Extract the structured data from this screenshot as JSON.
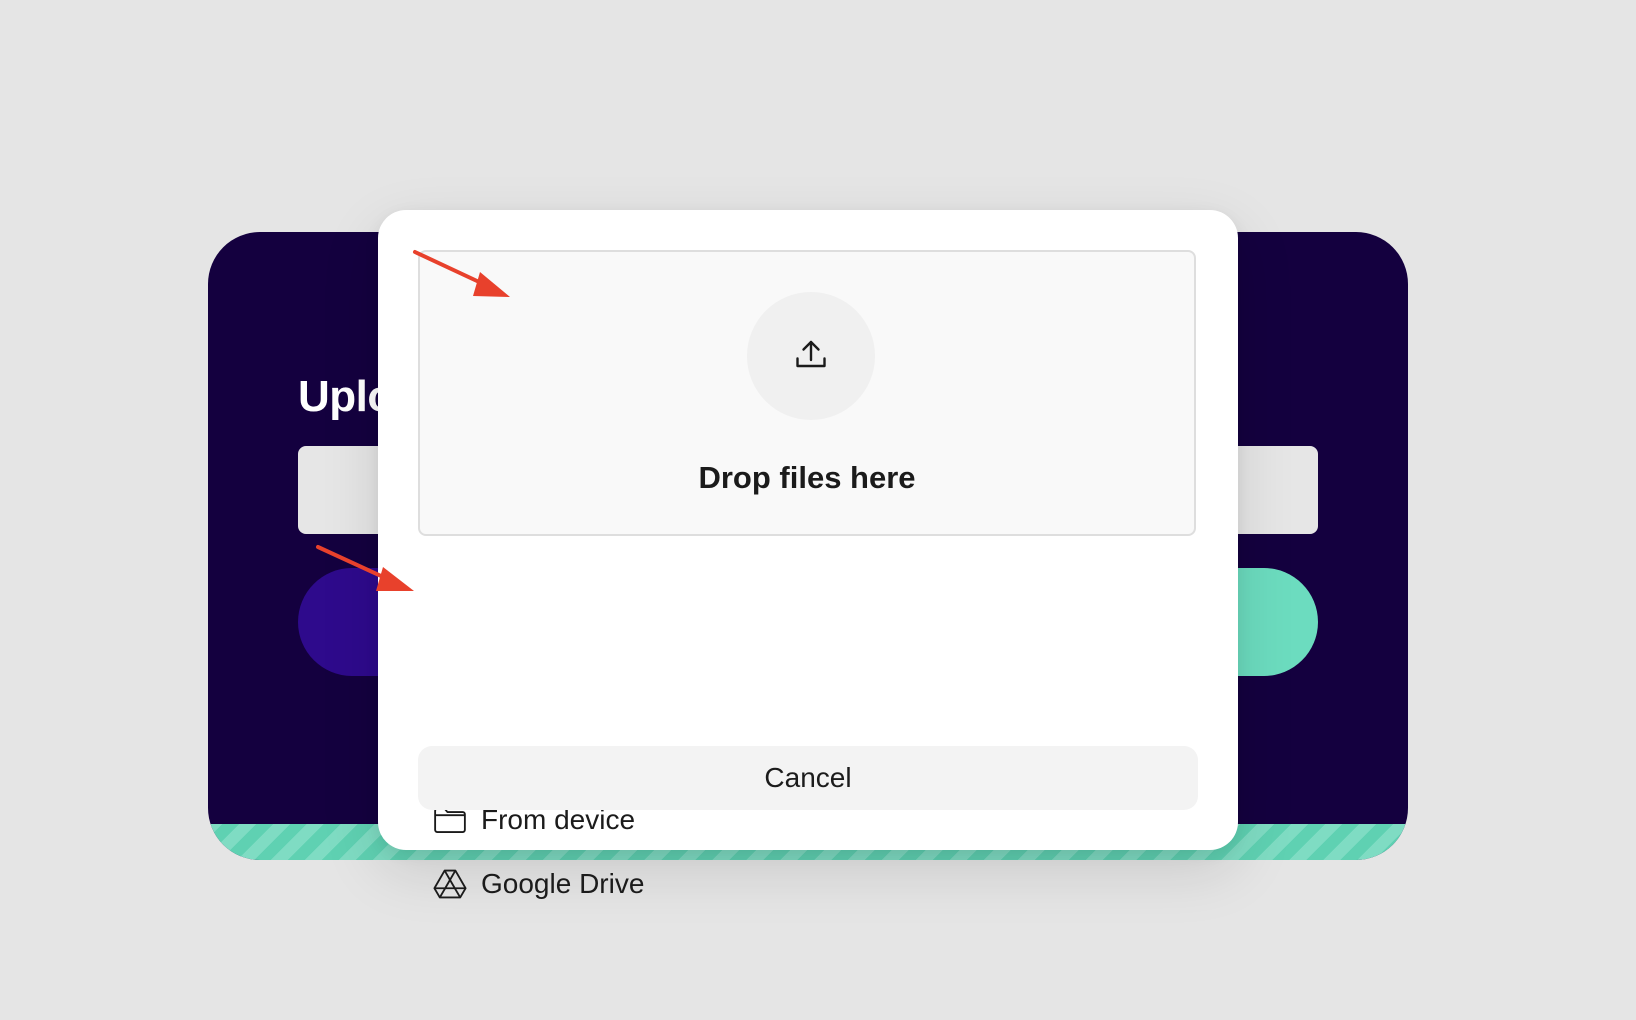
{
  "background_card": {
    "title": "Uplo"
  },
  "modal": {
    "dropzone": {
      "label": "Drop files here",
      "icon": "upload-icon"
    },
    "options": [
      {
        "label": "From device",
        "icon": "folder-icon"
      },
      {
        "label": "Google Drive",
        "icon": "google-drive-icon"
      }
    ],
    "cancel_label": "Cancel"
  },
  "colors": {
    "card_background": "#14003f",
    "card_button_left": "#2e0a8c",
    "card_button_right": "#6cdcbf",
    "stripe_accent": "#5fd1b2",
    "page_background": "#e5e5e5",
    "annotation_arrow": "#e8412c"
  }
}
